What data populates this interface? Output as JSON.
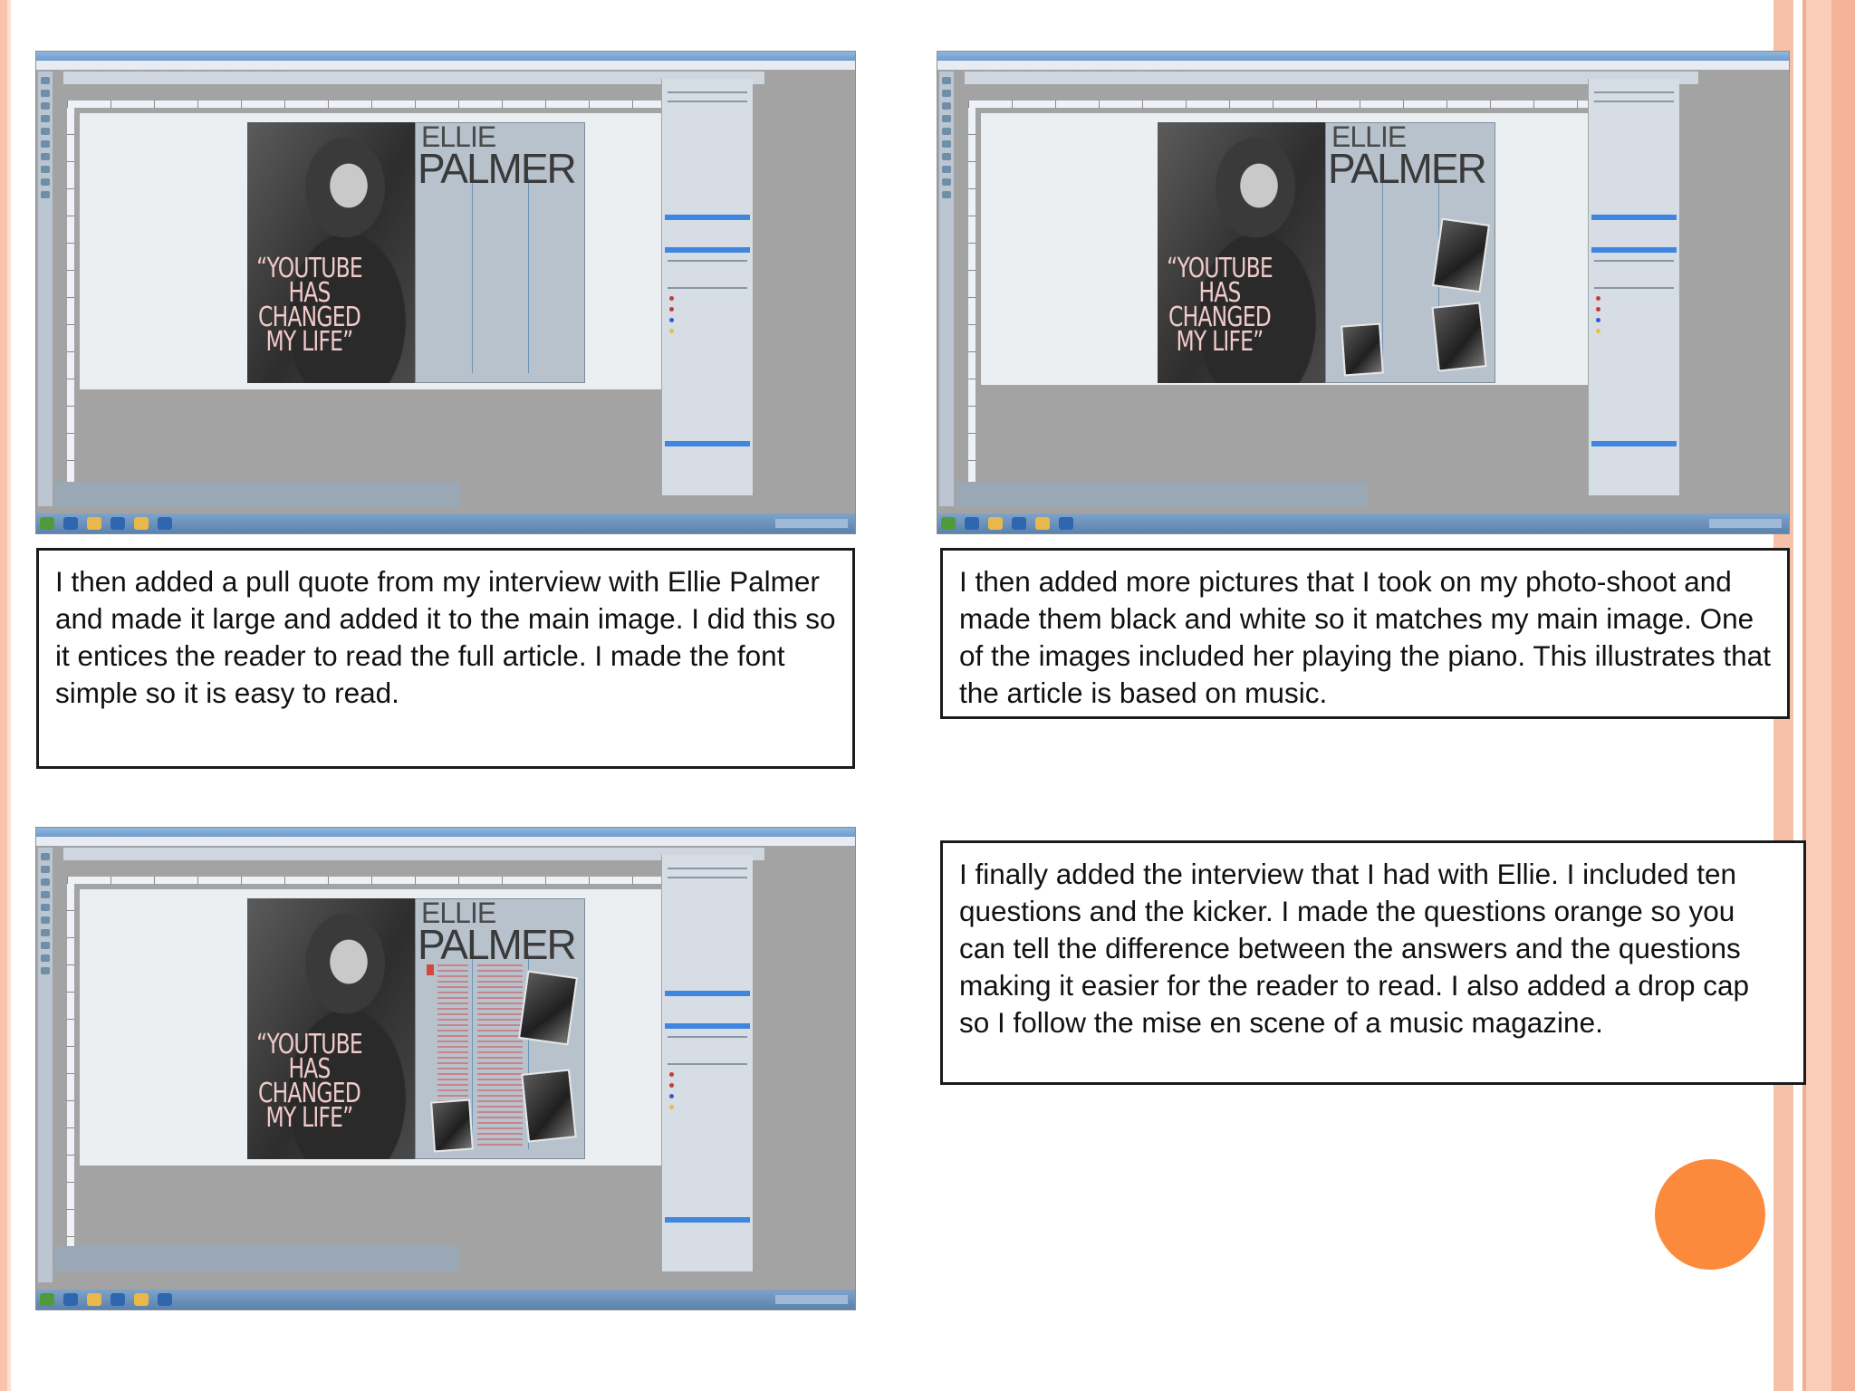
{
  "slide": {
    "captions": [
      "I then added a pull quote from my interview with Ellie Palmer and made it large and added it to the main image. I did this so it entices the reader to read the full article. I made the font simple so it is easy to read.",
      "I then added more pictures that I took on my photo-shoot and made them black and white so it matches my main image. One of the images included her playing the piano. This illustrates that the article is based on music.",
      "I finally added the interview that I had with Ellie. I included ten questions and the kicker. I made the questions orange so you can tell the difference between the answers and the questions making it easier for the reader to read. I also added a drop cap so I follow the mise en scene of a music magazine."
    ]
  },
  "magazine": {
    "first_name": "ELLIE",
    "last_name": "PALMER",
    "pull_quote": "“YOUTUBE HAS CHANGED MY LIFE”"
  },
  "colors": {
    "accent_circle": "#fb8a3c",
    "side_stripe": "#f7c0a8",
    "question_text": "#d4483c"
  }
}
